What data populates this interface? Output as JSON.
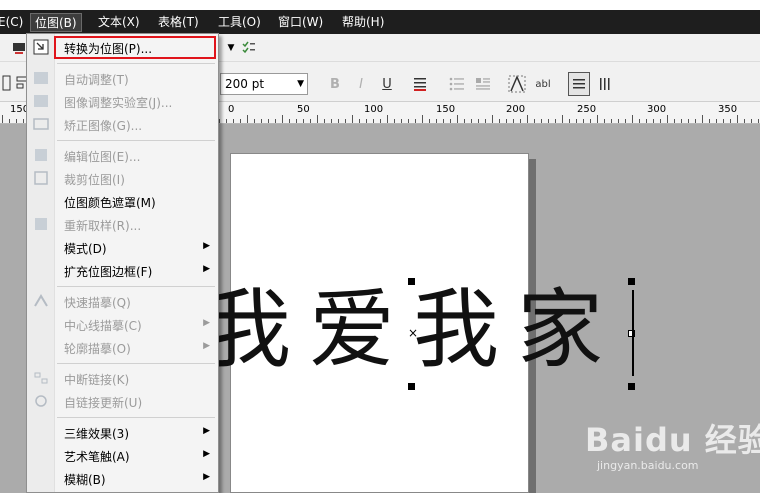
{
  "menubar": {
    "items": [
      {
        "label": "E(C)",
        "active": false
      },
      {
        "label": "位图(B)",
        "active": true
      },
      {
        "label": "文本(X)",
        "active": false
      },
      {
        "label": "表格(T)",
        "active": false
      },
      {
        "label": "工具(O)",
        "active": false
      },
      {
        "label": "窗口(W)",
        "active": false
      },
      {
        "label": "帮助(H)",
        "active": false
      }
    ]
  },
  "toolbar": {
    "font_size": "200 pt"
  },
  "ruler": {
    "labels": [
      "150",
      "0",
      "50",
      "100",
      "150",
      "200",
      "250",
      "300",
      "350"
    ]
  },
  "document": {
    "text": "我爱我家"
  },
  "bitmap_menu": {
    "items": [
      {
        "label": "转换为位图(P)...",
        "icon": "convert-bitmap-icon",
        "enabled": true,
        "highlight": true
      },
      {
        "label": "自动调整(T)",
        "icon": "auto-adjust-icon",
        "enabled": false
      },
      {
        "label": "图像调整实验室(J)...",
        "icon": "image-lab-icon",
        "enabled": false
      },
      {
        "label": "矫正图像(G)...",
        "icon": "straighten-icon",
        "enabled": false
      },
      {
        "label": "编辑位图(E)...",
        "icon": "edit-bitmap-icon",
        "enabled": false
      },
      {
        "label": "裁剪位图(I)",
        "icon": "crop-bitmap-icon",
        "enabled": false
      },
      {
        "label": "位图颜色遮罩(M)",
        "icon": "",
        "enabled": true
      },
      {
        "label": "重新取样(R)...",
        "icon": "resample-icon",
        "enabled": false
      },
      {
        "label": "模式(D)",
        "icon": "",
        "enabled": true,
        "submenu": true
      },
      {
        "label": "扩充位图边框(F)",
        "icon": "",
        "enabled": true,
        "submenu": true
      },
      {
        "label": "快速描摹(Q)",
        "icon": "quick-trace-icon",
        "enabled": false
      },
      {
        "label": "中心线描摹(C)",
        "icon": "",
        "enabled": false,
        "submenu": true
      },
      {
        "label": "轮廓描摹(O)",
        "icon": "",
        "enabled": false,
        "submenu": true
      },
      {
        "label": "中断链接(K)",
        "icon": "break-link-icon",
        "enabled": false
      },
      {
        "label": "自链接更新(U)",
        "icon": "update-link-icon",
        "enabled": false
      },
      {
        "label": "三维效果(3)",
        "icon": "",
        "enabled": true,
        "submenu": true
      },
      {
        "label": "艺术笔触(A)",
        "icon": "",
        "enabled": true,
        "submenu": true
      },
      {
        "label": "模糊(B)",
        "icon": "",
        "enabled": true,
        "submenu": true
      }
    ]
  },
  "watermark": {
    "logo": "Baidu 经验",
    "sub": "jingyan.baidu.com"
  },
  "colors": {
    "menubar_bg": "#1e1e1e",
    "highlight_border": "#e0141b"
  }
}
